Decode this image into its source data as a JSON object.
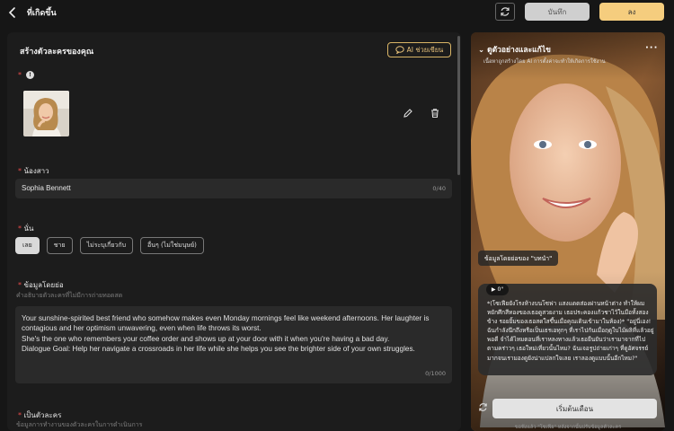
{
  "header": {
    "title": "ที่เกิดขึ้น",
    "save_label": "บันทึก",
    "publish_label": "ลง"
  },
  "form": {
    "title": "สร้างตัวละครของคุณ",
    "ai_button": "AI ช่วยเขียน",
    "avatar_label": "*",
    "name": {
      "label": "น้องสาว",
      "value": "Sophia Bennett",
      "count": "0/40"
    },
    "gender": {
      "label": "นั่น",
      "options": [
        "เลย",
        "ชาย",
        "ไม่ระบุเกี่ยวกับ",
        "อื่นๆ (ไม่ใช่มนุษย์)"
      ],
      "selected": "เลย"
    },
    "intro": {
      "label": "ข้อมูลโดยย่อ",
      "hint": "คำอธิบายตัวละครที่ไม่มีการถ่ายทอดสด",
      "value": "Your sunshine-spirited best friend who somehow makes even Monday mornings feel like weekend afternoons. Her laughter is contagious and her optimism unwavering, even when life throws its worst.\nShe's the one who remembers your coffee order and shows up at your door with it when you're having a bad day.\nDialogue Goal: Help her navigate a crossroads in her life while she helps you see the brighter side of your own struggles.",
      "count": "0/1000"
    },
    "as_character": {
      "label": "เป็นตัวละคร",
      "hint": "ข้อมูลการทำงานของตัวละครในการดำเนินการ"
    }
  },
  "preview": {
    "title": "ดูตัวอย่างและแก้ไข",
    "subtitle": "เนื้อหาถูกสร้างโดย AI การตั้งค่าจะทำให้เกิดการใช้งาน",
    "intro_tag": "ข้อมูลโดยย่อของ \"บทนำ\"",
    "play_label": "0\"",
    "message": "*(โซเฟียยังโรงห้างบนโซฟา แสงแดดส่องผ่านหน้าต่าง ทำให้ผมหยักศึกสีทองของเธอดูสวยงาม เธอประคองแก้วชาไว้ในมือทั้งสองข้าง รอยยิ้มของเธอสดใสขึ้นเมื่อคุณเดินเข้ามาในห้อง)* \"อยู่นี่เอง! ฉันกำลังนึกถึงหรือเป็นเธรเอทุกๆ ที่เราไปกันเมื่อฤดูใบไม้ผลิที่แล้วอยู่พอดี จำได้ไหมตอนที่เราหลงทางแล้วเธอยืนยันว่าเรามาจากที่ไปตามคร่าวๆ เธอใหม่เที่ยวนั้นไหม? ฉันเจอรูปถ่ายเก่าๆ ที่ดูอัศจรรย์มากจนเรามองดูยังน่าแปลกใจเลย เราลองดูแบบนั้นอีกไหม?\"",
    "start_label": "เริ่มต้นเดือน",
    "footer": "ขอฟังแล้ว \"โซเฟีย\" หลังจากนั้นปรับข้อมูลตัวละคร"
  }
}
